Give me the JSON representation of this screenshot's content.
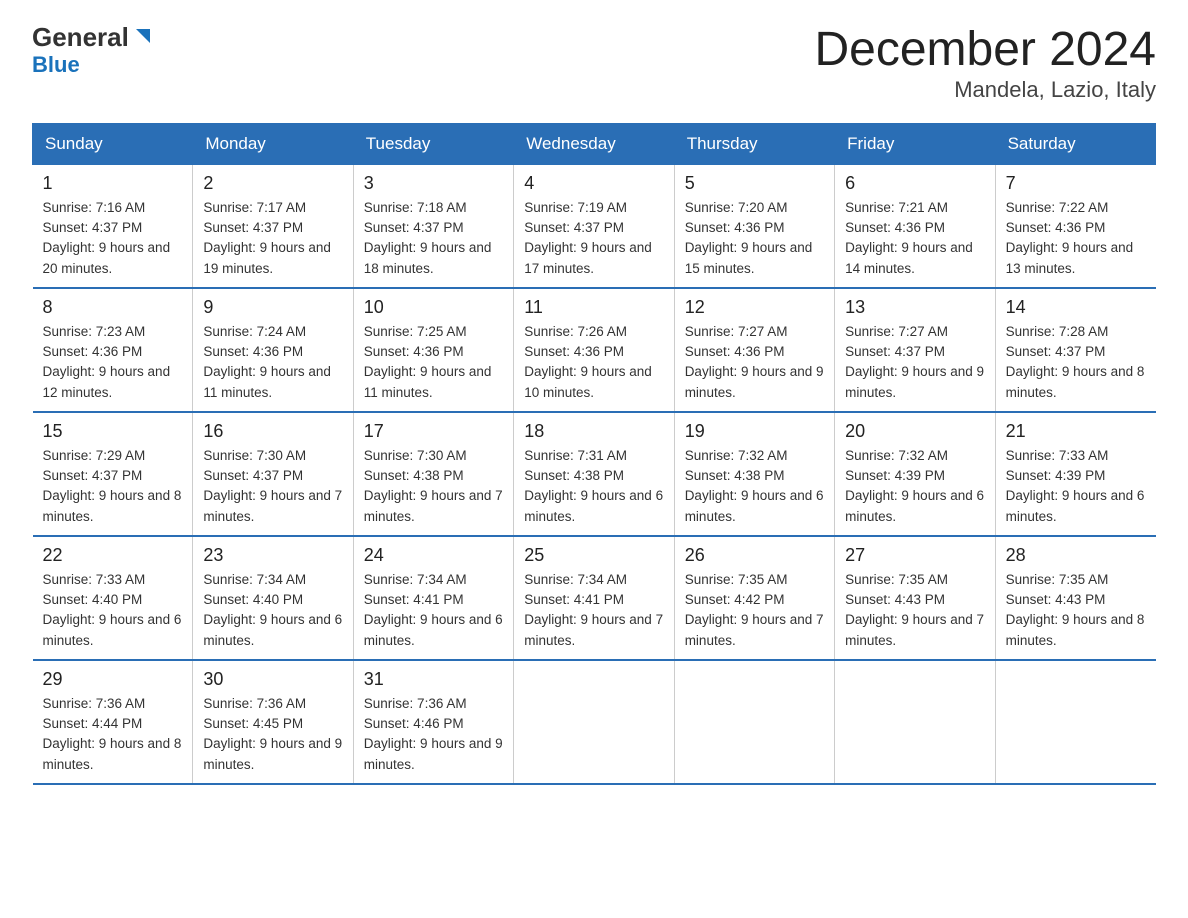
{
  "header": {
    "logo_general": "General",
    "logo_blue": "Blue",
    "title": "December 2024",
    "subtitle": "Mandela, Lazio, Italy"
  },
  "weekdays": [
    "Sunday",
    "Monday",
    "Tuesday",
    "Wednesday",
    "Thursday",
    "Friday",
    "Saturday"
  ],
  "weeks": [
    [
      {
        "day": "1",
        "sunrise": "7:16 AM",
        "sunset": "4:37 PM",
        "daylight": "9 hours and 20 minutes."
      },
      {
        "day": "2",
        "sunrise": "7:17 AM",
        "sunset": "4:37 PM",
        "daylight": "9 hours and 19 minutes."
      },
      {
        "day": "3",
        "sunrise": "7:18 AM",
        "sunset": "4:37 PM",
        "daylight": "9 hours and 18 minutes."
      },
      {
        "day": "4",
        "sunrise": "7:19 AM",
        "sunset": "4:37 PM",
        "daylight": "9 hours and 17 minutes."
      },
      {
        "day": "5",
        "sunrise": "7:20 AM",
        "sunset": "4:36 PM",
        "daylight": "9 hours and 15 minutes."
      },
      {
        "day": "6",
        "sunrise": "7:21 AM",
        "sunset": "4:36 PM",
        "daylight": "9 hours and 14 minutes."
      },
      {
        "day": "7",
        "sunrise": "7:22 AM",
        "sunset": "4:36 PM",
        "daylight": "9 hours and 13 minutes."
      }
    ],
    [
      {
        "day": "8",
        "sunrise": "7:23 AM",
        "sunset": "4:36 PM",
        "daylight": "9 hours and 12 minutes."
      },
      {
        "day": "9",
        "sunrise": "7:24 AM",
        "sunset": "4:36 PM",
        "daylight": "9 hours and 11 minutes."
      },
      {
        "day": "10",
        "sunrise": "7:25 AM",
        "sunset": "4:36 PM",
        "daylight": "9 hours and 11 minutes."
      },
      {
        "day": "11",
        "sunrise": "7:26 AM",
        "sunset": "4:36 PM",
        "daylight": "9 hours and 10 minutes."
      },
      {
        "day": "12",
        "sunrise": "7:27 AM",
        "sunset": "4:36 PM",
        "daylight": "9 hours and 9 minutes."
      },
      {
        "day": "13",
        "sunrise": "7:27 AM",
        "sunset": "4:37 PM",
        "daylight": "9 hours and 9 minutes."
      },
      {
        "day": "14",
        "sunrise": "7:28 AM",
        "sunset": "4:37 PM",
        "daylight": "9 hours and 8 minutes."
      }
    ],
    [
      {
        "day": "15",
        "sunrise": "7:29 AM",
        "sunset": "4:37 PM",
        "daylight": "9 hours and 8 minutes."
      },
      {
        "day": "16",
        "sunrise": "7:30 AM",
        "sunset": "4:37 PM",
        "daylight": "9 hours and 7 minutes."
      },
      {
        "day": "17",
        "sunrise": "7:30 AM",
        "sunset": "4:38 PM",
        "daylight": "9 hours and 7 minutes."
      },
      {
        "day": "18",
        "sunrise": "7:31 AM",
        "sunset": "4:38 PM",
        "daylight": "9 hours and 6 minutes."
      },
      {
        "day": "19",
        "sunrise": "7:32 AM",
        "sunset": "4:38 PM",
        "daylight": "9 hours and 6 minutes."
      },
      {
        "day": "20",
        "sunrise": "7:32 AM",
        "sunset": "4:39 PM",
        "daylight": "9 hours and 6 minutes."
      },
      {
        "day": "21",
        "sunrise": "7:33 AM",
        "sunset": "4:39 PM",
        "daylight": "9 hours and 6 minutes."
      }
    ],
    [
      {
        "day": "22",
        "sunrise": "7:33 AM",
        "sunset": "4:40 PM",
        "daylight": "9 hours and 6 minutes."
      },
      {
        "day": "23",
        "sunrise": "7:34 AM",
        "sunset": "4:40 PM",
        "daylight": "9 hours and 6 minutes."
      },
      {
        "day": "24",
        "sunrise": "7:34 AM",
        "sunset": "4:41 PM",
        "daylight": "9 hours and 6 minutes."
      },
      {
        "day": "25",
        "sunrise": "7:34 AM",
        "sunset": "4:41 PM",
        "daylight": "9 hours and 7 minutes."
      },
      {
        "day": "26",
        "sunrise": "7:35 AM",
        "sunset": "4:42 PM",
        "daylight": "9 hours and 7 minutes."
      },
      {
        "day": "27",
        "sunrise": "7:35 AM",
        "sunset": "4:43 PM",
        "daylight": "9 hours and 7 minutes."
      },
      {
        "day": "28",
        "sunrise": "7:35 AM",
        "sunset": "4:43 PM",
        "daylight": "9 hours and 8 minutes."
      }
    ],
    [
      {
        "day": "29",
        "sunrise": "7:36 AM",
        "sunset": "4:44 PM",
        "daylight": "9 hours and 8 minutes."
      },
      {
        "day": "30",
        "sunrise": "7:36 AM",
        "sunset": "4:45 PM",
        "daylight": "9 hours and 9 minutes."
      },
      {
        "day": "31",
        "sunrise": "7:36 AM",
        "sunset": "4:46 PM",
        "daylight": "9 hours and 9 minutes."
      },
      null,
      null,
      null,
      null
    ]
  ]
}
